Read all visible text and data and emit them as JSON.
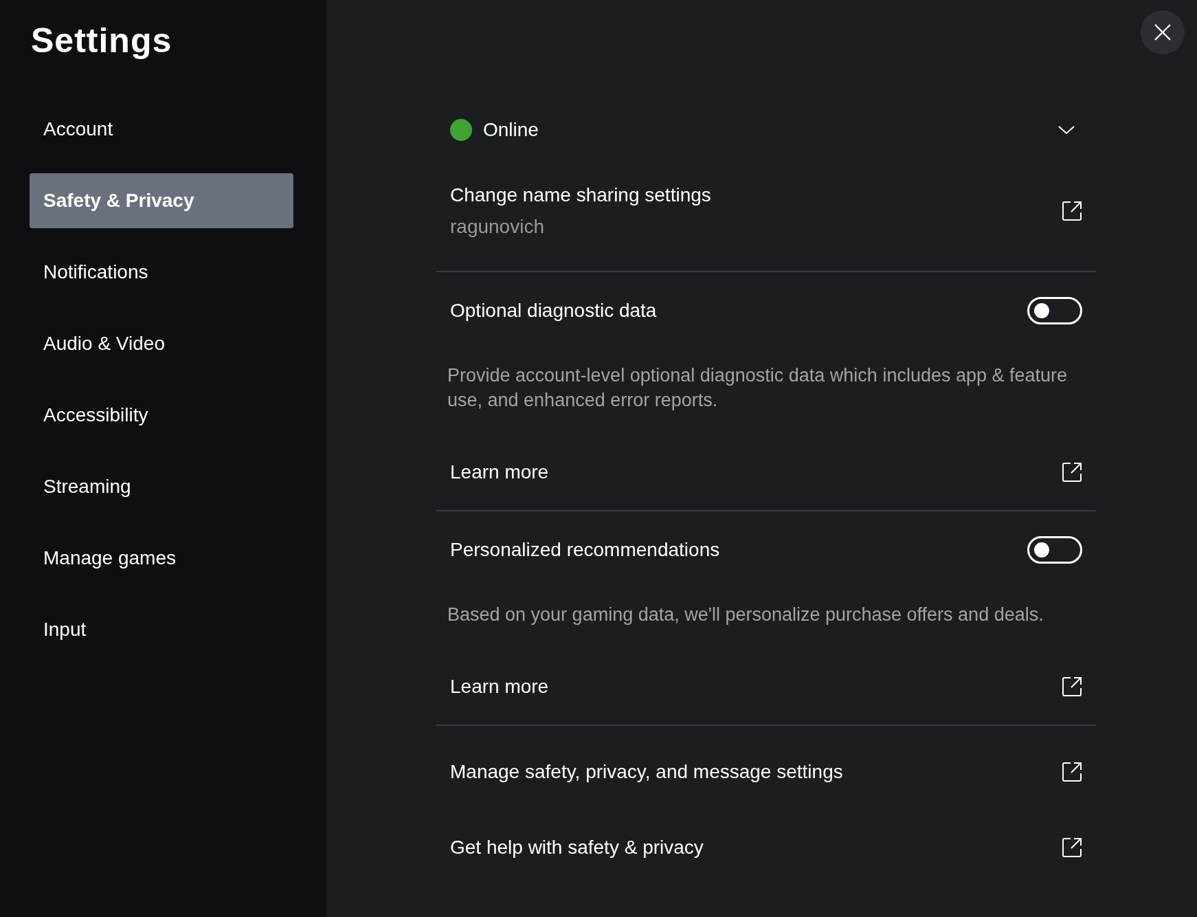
{
  "title": "Settings",
  "nav": [
    {
      "label": "Account",
      "selected": false
    },
    {
      "label": "Safety & Privacy",
      "selected": true
    },
    {
      "label": "Notifications",
      "selected": false
    },
    {
      "label": "Audio & Video",
      "selected": false
    },
    {
      "label": "Accessibility",
      "selected": false
    },
    {
      "label": "Streaming",
      "selected": false
    },
    {
      "label": "Manage games",
      "selected": false
    },
    {
      "label": "Input",
      "selected": false
    }
  ],
  "sections": [
    {
      "rows": [
        {
          "kind": "status",
          "label": "Online",
          "color": "#3ea532"
        },
        {
          "kind": "link",
          "label": "Change name sharing settings",
          "sublabel": "ragunovich"
        }
      ]
    },
    {
      "rows": [
        {
          "kind": "toggle",
          "label": "Optional diagnostic data",
          "on": false
        },
        {
          "kind": "description",
          "text": "Provide account-level optional diagnostic data which includes app & feature use, and enhanced error reports."
        },
        {
          "kind": "link",
          "label": "Learn more"
        }
      ]
    },
    {
      "rows": [
        {
          "kind": "toggle",
          "label": "Personalized recommendations",
          "on": false
        },
        {
          "kind": "description",
          "text": "Based on your gaming data, we'll personalize purchase offers and deals."
        },
        {
          "kind": "link",
          "label": "Learn more"
        }
      ]
    },
    {
      "rows": [
        {
          "kind": "link",
          "label": "Manage safety, privacy, and message settings"
        },
        {
          "kind": "link",
          "label": "Get help with safety & privacy"
        }
      ]
    }
  ]
}
